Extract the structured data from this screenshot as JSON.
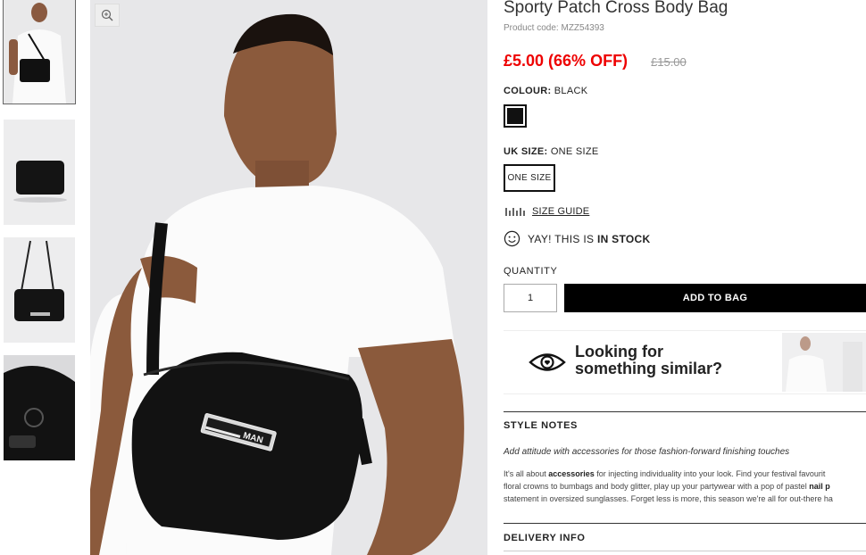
{
  "product": {
    "title": "Sporty Patch Cross Body Bag",
    "code": "Product code: MZZ54393",
    "price": "£5.00 (66% OFF)",
    "old_price": "£15.00"
  },
  "colour": {
    "label": "COLOUR:",
    "value": "BLACK",
    "swatch_color": "#111111"
  },
  "size": {
    "label": "UK SIZE:",
    "value": "ONE SIZE",
    "option": "ONE SIZE"
  },
  "size_guide": {
    "label": "SIZE GUIDE",
    "icon": "ruler-icon"
  },
  "stock": {
    "prefix": "YAY! THIS IS",
    "status": "IN STOCK",
    "icon": "smiley-icon"
  },
  "quantity": {
    "label": "QUANTITY",
    "value": "1"
  },
  "add_to_bag": "ADD TO BAG",
  "similar": {
    "line1": "Looking for",
    "line2": "something similar?",
    "icon": "eye-icon"
  },
  "style_notes": {
    "heading": "STYLE NOTES",
    "tagline": "Add attitude with accessories for those fashion-forward finishing touches",
    "p1a": "It's all about ",
    "p1b": "accessories",
    "p1c": " for injecting individuality into your look. Find your festival favourit",
    "p2a": "floral crowns to bumbags and body glitter, play up your partywear with a pop of pastel ",
    "p2b": "nail p",
    "p3": "statement in oversized sunglasses. Forget less is more, this season we're all for out-there ha"
  },
  "delivery": {
    "heading": "DELIVERY INFO"
  },
  "bag_label": "MAN"
}
